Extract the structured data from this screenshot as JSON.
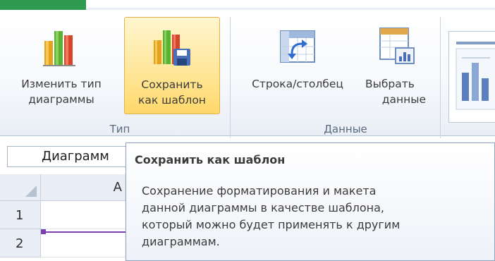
{
  "ribbon": {
    "buttons": {
      "change_type": {
        "line1": "Изменить тип",
        "line2": "диаграммы"
      },
      "save_template": {
        "line1": "Сохранить",
        "line2": "как шаблон"
      },
      "switch_row_col": {
        "line1": "Строка/столбец"
      },
      "select_data": {
        "line1": "Выбрать",
        "line2": "данные"
      }
    },
    "groups": {
      "type": "Тип",
      "data": "Данные"
    }
  },
  "name_box": {
    "value": "Диаграмм"
  },
  "sheet": {
    "column_a": "A",
    "rows": [
      "1",
      "2"
    ]
  },
  "tooltip": {
    "title": "Сохранить как шаблон",
    "body_lines": [
      "Сохранение форматирования и макета",
      "данной диаграммы в качестве шаблона,",
      "который можно будет применять к другим",
      "диаграммам."
    ]
  },
  "colors": {
    "hover_fill": "#ffe79b",
    "hover_border": "#e2b14c",
    "chart_selection": "#7a3fb0",
    "ribbon_tab_accent": "#2e9a4f"
  },
  "icons": {
    "change_type": "bar-chart-icon",
    "save_template": "bar-chart-save-icon",
    "switch_row_col": "switch-row-column-icon",
    "select_data": "select-data-icon",
    "chart_layouts": "chart-layout-gallery-icon"
  }
}
